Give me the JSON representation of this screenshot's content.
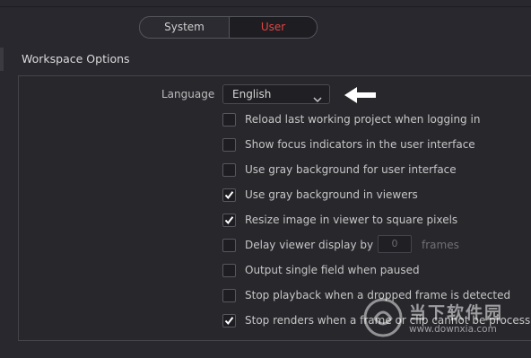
{
  "tabs": {
    "system": "System",
    "user": "User",
    "active": "User"
  },
  "section": {
    "title": "Workspace Options"
  },
  "language": {
    "label": "Language",
    "value": "English"
  },
  "options": [
    {
      "label": "Reload last working project when logging in",
      "checked": false
    },
    {
      "label": "Show focus indicators in the user interface",
      "checked": false
    },
    {
      "label": "Use gray background for user interface",
      "checked": false
    },
    {
      "label": "Use gray background in viewers",
      "checked": true
    },
    {
      "label": "Resize image in viewer to square pixels",
      "checked": true
    },
    {
      "label": "Delay viewer display by",
      "checked": false
    },
    {
      "label": "Output single field when paused",
      "checked": false
    },
    {
      "label": "Stop playback when a dropped frame is detected",
      "checked": false
    },
    {
      "label": "Stop renders when a frame or clip cannot be processed",
      "checked": true
    }
  ],
  "delay": {
    "value": "0",
    "unit": "frames"
  },
  "watermark": {
    "name": "当下软件园",
    "url": "www.downxia.com"
  },
  "colors": {
    "accent": "#e14545",
    "background": "#28282e"
  }
}
